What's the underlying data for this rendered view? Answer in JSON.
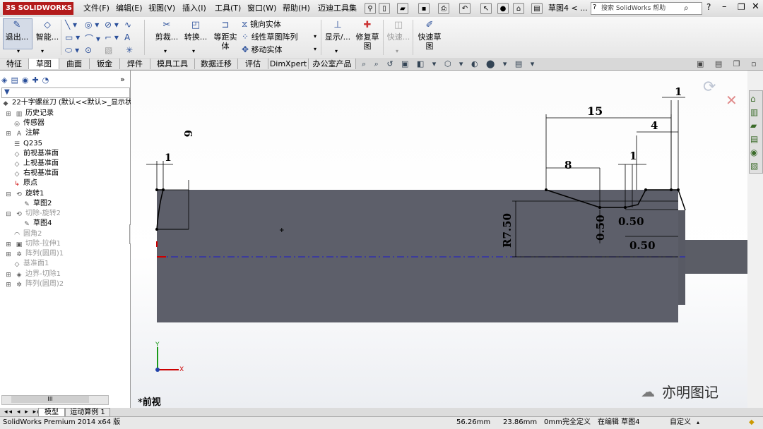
{
  "titlebar": {
    "logo": "3S SOLIDWORKS",
    "menus": [
      "文件(F)",
      "编辑(E)",
      "视图(V)",
      "插入(I)",
      "工具(T)",
      "窗口(W)",
      "帮助(H)",
      "迈迪工具集"
    ],
    "doc_title": "草图4 < ...",
    "search_placeholder": "搜索 SolidWorks 帮助"
  },
  "ribbon": {
    "exit_sketch": "退出...",
    "smart_dim": "智能...",
    "trim": "剪裁...",
    "convert": "转换...",
    "offset_line1": "等距实",
    "offset_line2": "体",
    "mirror": "镜向实体",
    "linear_pattern": "线性草图阵列",
    "move": "移动实体",
    "display": "显示/...",
    "repair_line1": "修复草",
    "repair_line2": "图",
    "quick_snaps": "快速...",
    "rapid_sketch_line1": "快速草",
    "rapid_sketch_line2": "图"
  },
  "tabs": [
    "特征",
    "草图",
    "曲面",
    "钣金",
    "焊件",
    "模具工具",
    "数据迁移",
    "评估",
    "DimXpert",
    "办公室产品"
  ],
  "tree": {
    "root": "22十字螺丝刀 (默认<<默认>_显示状态",
    "items": [
      "历史记录",
      "传感器",
      "注解",
      "Q235",
      "前视基准面",
      "上视基准面",
      "右视基准面",
      "原点",
      "旋转1",
      "草图2",
      "切除-旋转2",
      "草图4",
      "圆角2",
      "切除-拉伸1",
      "阵列(圆周)1",
      "基准面1",
      "边界-切除1",
      "阵列(圆周)2"
    ]
  },
  "bottom_tabs": {
    "model": "模型",
    "motion": "运动算例 1"
  },
  "view_label": "*前视",
  "dimensions": [
    "1",
    "15",
    "1",
    "4",
    "8",
    "1",
    "6",
    "R7.50",
    "0.50",
    "0.50",
    "0.50"
  ],
  "watermark": "亦明图记",
  "status": {
    "product": "SolidWorks Premium 2014 x64 版",
    "x": "56.26mm",
    "y": "23.86mm",
    "z": "0mm",
    "defined": "完全定义",
    "editing": "在编辑 草图4",
    "custom": "自定义"
  },
  "axes": {
    "x": "X",
    "y": "Y"
  },
  "colors": {
    "part_fill": "#5d5f6a",
    "centerline": "#1a1acc",
    "logo": "#b31b1b",
    "origin": "#cc0000"
  }
}
